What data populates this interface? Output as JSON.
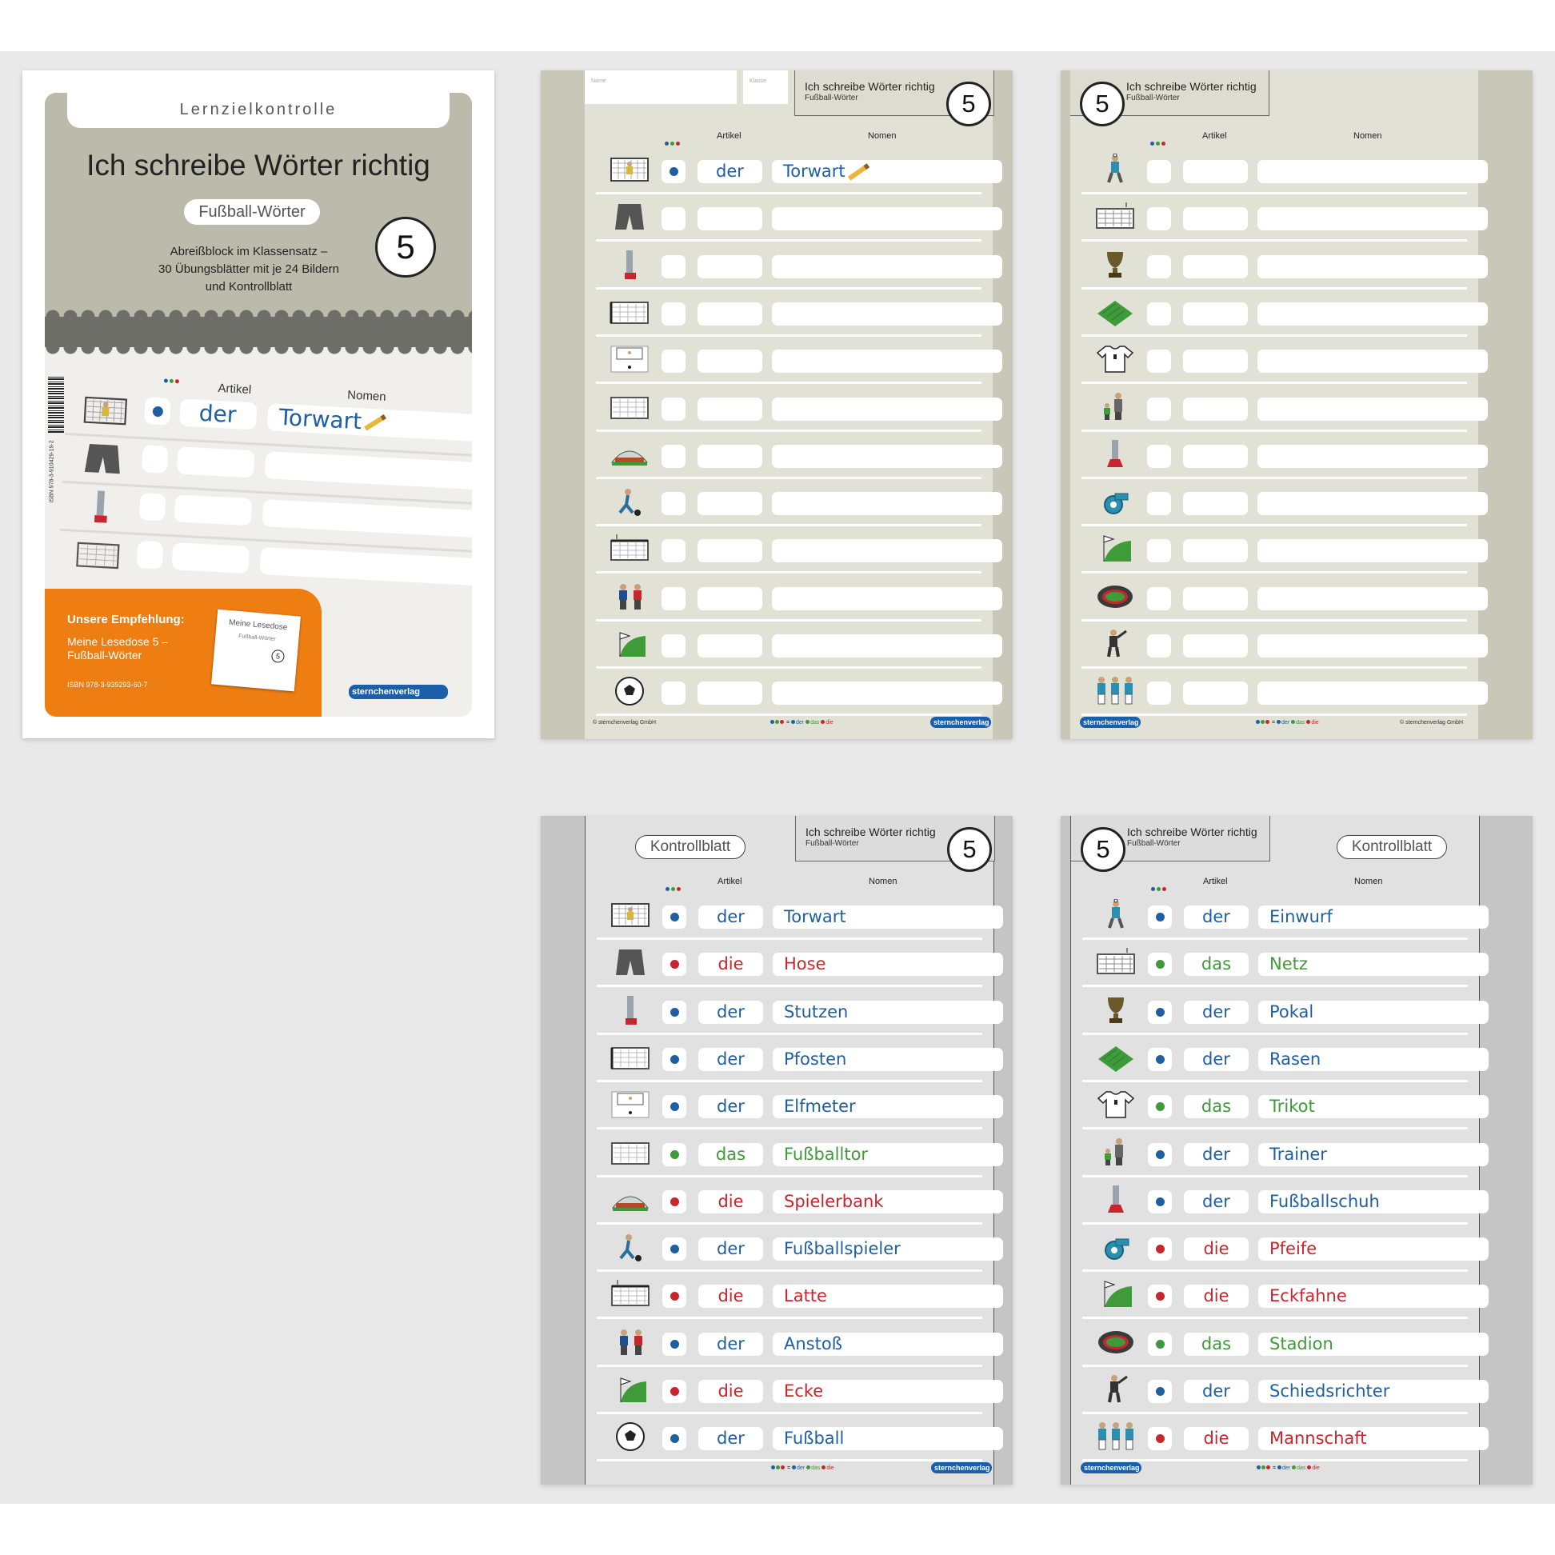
{
  "colors": {
    "blue": "#1f5f9f",
    "red": "#c8262d",
    "green": "#3f9a3a",
    "orange": "#ee7d12",
    "brand": "#1a5fa8"
  },
  "cover": {
    "tab": "Lernzielkontrolle",
    "title": "Ich schreibe Wörter richtig",
    "subtitle": "Fußball-Wörter",
    "number": "5",
    "description": [
      "Abreißblock im Klassensatz –",
      "30 Übungsblätter mit je 24 Bildern",
      "und Kontrollblatt"
    ],
    "sample_header_artikel": "Artikel",
    "sample_header_nomen": "Nomen",
    "sample_article": "der",
    "sample_noun": "Torwart",
    "recommendation_head": "Unsere Empfehlung:",
    "recommendation_text": "Meine Lesedose 5 – Fußball-Wörter",
    "recommendation_isbn": "ISBN 978-3-939293-60-7",
    "card_title": "Meine Lesedose",
    "card_sub": "Fußball-Wörter",
    "card_num": "5",
    "side_isbn": "ISBN 978-3-910429-19-2",
    "brand": "sternchenverlag"
  },
  "common": {
    "sheet_title": "Ich schreibe Wörter richtig",
    "sheet_subtitle": "Fußball-Wörter",
    "number": "5",
    "artikel": "Artikel",
    "nomen": "Nomen",
    "name_label": "Name",
    "klasse_label": "Klasse",
    "kontrollblatt": "Kontrollblatt",
    "copyright": "© sternchenverlag GmbH",
    "legend_der": "der",
    "legend_das": "das",
    "legend_die": "die",
    "brand": "sternchenverlag"
  },
  "sheets": [
    {
      "id": "sheet1",
      "rows": [
        {
          "icon": "goal-keeper-icon",
          "dot": "blue",
          "article": "der",
          "noun": "Torwart",
          "pencil": true
        },
        {
          "icon": "shorts-icon",
          "dot": "",
          "article": "",
          "noun": ""
        },
        {
          "icon": "sock-leg-icon",
          "dot": "",
          "article": "",
          "noun": ""
        },
        {
          "icon": "goal-post-icon",
          "dot": "",
          "article": "",
          "noun": ""
        },
        {
          "icon": "penalty-icon",
          "dot": "",
          "article": "",
          "noun": ""
        },
        {
          "icon": "goal-icon",
          "dot": "",
          "article": "",
          "noun": ""
        },
        {
          "icon": "bench-icon",
          "dot": "",
          "article": "",
          "noun": ""
        },
        {
          "icon": "player-icon",
          "dot": "",
          "article": "",
          "noun": ""
        },
        {
          "icon": "crossbar-icon",
          "dot": "",
          "article": "",
          "noun": ""
        },
        {
          "icon": "kickoff-icon",
          "dot": "",
          "article": "",
          "noun": ""
        },
        {
          "icon": "corner-icon",
          "dot": "",
          "article": "",
          "noun": ""
        },
        {
          "icon": "ball-icon",
          "dot": "",
          "article": "",
          "noun": ""
        }
      ]
    },
    {
      "id": "sheet2",
      "rows": [
        {
          "icon": "throw-in-icon",
          "dot": "",
          "article": "",
          "noun": ""
        },
        {
          "icon": "net-icon",
          "dot": "",
          "article": "",
          "noun": ""
        },
        {
          "icon": "trophy-icon",
          "dot": "",
          "article": "",
          "noun": ""
        },
        {
          "icon": "lawn-icon",
          "dot": "",
          "article": "",
          "noun": ""
        },
        {
          "icon": "jersey-icon",
          "dot": "",
          "article": "",
          "noun": ""
        },
        {
          "icon": "trainer-icon",
          "dot": "",
          "article": "",
          "noun": ""
        },
        {
          "icon": "boot-icon",
          "dot": "",
          "article": "",
          "noun": ""
        },
        {
          "icon": "whistle-icon",
          "dot": "",
          "article": "",
          "noun": ""
        },
        {
          "icon": "corner-flag-icon",
          "dot": "",
          "article": "",
          "noun": ""
        },
        {
          "icon": "stadium-icon",
          "dot": "",
          "article": "",
          "noun": ""
        },
        {
          "icon": "referee-icon",
          "dot": "",
          "article": "",
          "noun": ""
        },
        {
          "icon": "team-icon",
          "dot": "",
          "article": "",
          "noun": ""
        }
      ]
    },
    {
      "id": "sheet3",
      "rows": [
        {
          "icon": "goal-keeper-icon",
          "dot": "blue",
          "article": "der",
          "noun": "Torwart"
        },
        {
          "icon": "shorts-icon",
          "dot": "red",
          "article": "die",
          "noun": "Hose"
        },
        {
          "icon": "sock-leg-icon",
          "dot": "blue",
          "article": "der",
          "noun": "Stutzen"
        },
        {
          "icon": "goal-post-icon",
          "dot": "blue",
          "article": "der",
          "noun": "Pfosten"
        },
        {
          "icon": "penalty-icon",
          "dot": "blue",
          "article": "der",
          "noun": "Elfmeter"
        },
        {
          "icon": "goal-icon",
          "dot": "green",
          "article": "das",
          "noun": "Fußballtor"
        },
        {
          "icon": "bench-icon",
          "dot": "red",
          "article": "die",
          "noun": "Spielerbank"
        },
        {
          "icon": "player-icon",
          "dot": "blue",
          "article": "der",
          "noun": "Fußballspieler"
        },
        {
          "icon": "crossbar-icon",
          "dot": "red",
          "article": "die",
          "noun": "Latte"
        },
        {
          "icon": "kickoff-icon",
          "dot": "blue",
          "article": "der",
          "noun": "Anstoß"
        },
        {
          "icon": "corner-icon",
          "dot": "red",
          "article": "die",
          "noun": "Ecke"
        },
        {
          "icon": "ball-icon",
          "dot": "blue",
          "article": "der",
          "noun": "Fußball"
        }
      ]
    },
    {
      "id": "sheet4",
      "rows": [
        {
          "icon": "throw-in-icon",
          "dot": "blue",
          "article": "der",
          "noun": "Einwurf"
        },
        {
          "icon": "net-icon",
          "dot": "green",
          "article": "das",
          "noun": "Netz"
        },
        {
          "icon": "trophy-icon",
          "dot": "blue",
          "article": "der",
          "noun": "Pokal"
        },
        {
          "icon": "lawn-icon",
          "dot": "blue",
          "article": "der",
          "noun": "Rasen"
        },
        {
          "icon": "jersey-icon",
          "dot": "green",
          "article": "das",
          "noun": "Trikot"
        },
        {
          "icon": "trainer-icon",
          "dot": "blue",
          "article": "der",
          "noun": "Trainer"
        },
        {
          "icon": "boot-icon",
          "dot": "blue",
          "article": "der",
          "noun": "Fußballschuh"
        },
        {
          "icon": "whistle-icon",
          "dot": "red",
          "article": "die",
          "noun": "Pfeife"
        },
        {
          "icon": "corner-flag-icon",
          "dot": "red",
          "article": "die",
          "noun": "Eckfahne"
        },
        {
          "icon": "stadium-icon",
          "dot": "green",
          "article": "das",
          "noun": "Stadion"
        },
        {
          "icon": "referee-icon",
          "dot": "blue",
          "article": "der",
          "noun": "Schiedsrichter"
        },
        {
          "icon": "team-icon",
          "dot": "red",
          "article": "die",
          "noun": "Mannschaft"
        }
      ]
    }
  ]
}
